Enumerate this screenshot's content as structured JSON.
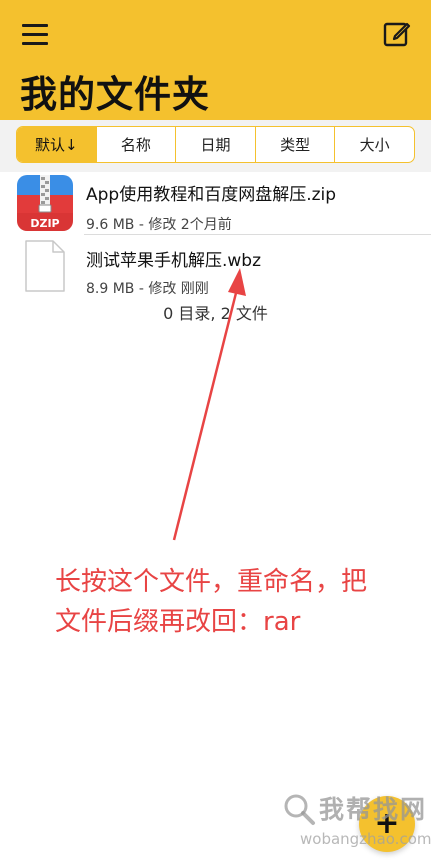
{
  "header": {
    "title": "我的文件夹",
    "background": "#f4c12e",
    "menu_icon": "hamburger-menu-icon",
    "edit_icon": "edit-square-icon"
  },
  "sort_tabs": [
    {
      "label": "默认↓",
      "active": true
    },
    {
      "label": "名称",
      "active": false
    },
    {
      "label": "日期",
      "active": false
    },
    {
      "label": "类型",
      "active": false
    },
    {
      "label": "大小",
      "active": false
    }
  ],
  "files": [
    {
      "name": "App使用教程和百度网盘解压.zip",
      "meta": "9.6 MB - 修改 2个月前",
      "icon": "dzip-archive-icon",
      "icon_label": "DZIP"
    },
    {
      "name": "测试苹果手机解压.wbz",
      "meta": "8.9 MB - 修改 刚刚",
      "icon": "document-icon"
    }
  ],
  "summary": "0 目录, 2 文件",
  "annotation": {
    "line1": "长按这个文件，重命名，把",
    "line2": "文件后缀再改回：rar",
    "color": "#e84444"
  },
  "fab": {
    "label": "+"
  },
  "watermark": {
    "cn": "我帮找网",
    "en": "wobangzhao.com"
  }
}
